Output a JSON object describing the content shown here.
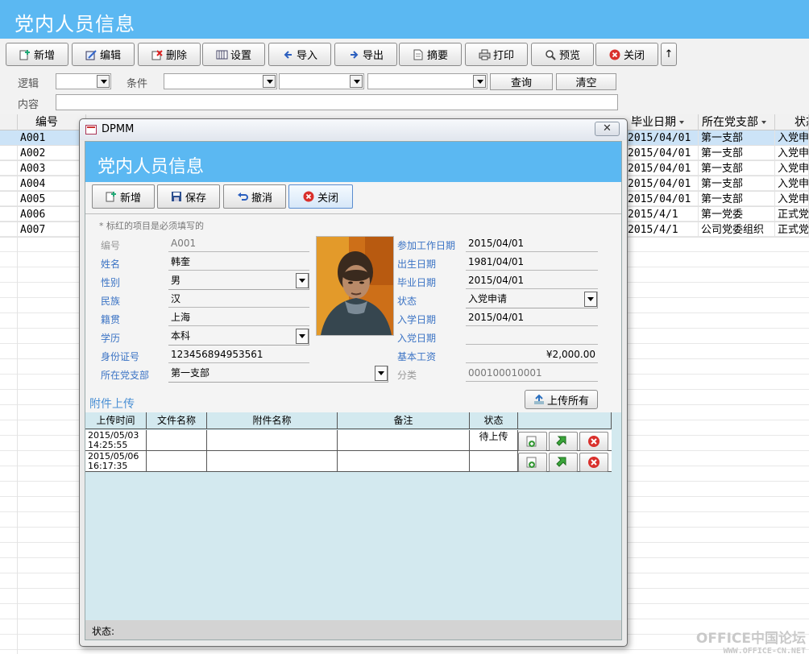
{
  "app": {
    "title": "党内人员信息"
  },
  "toolbar": [
    {
      "label": "新增",
      "icon": "new-icon"
    },
    {
      "label": "编辑",
      "icon": "edit-icon"
    },
    {
      "label": "删除",
      "icon": "delete-icon"
    },
    {
      "label": "设置",
      "icon": "settings-icon"
    },
    {
      "label": "导入",
      "icon": "import-icon"
    },
    {
      "label": "导出",
      "icon": "export-icon"
    },
    {
      "label": "摘要",
      "icon": "summary-icon"
    },
    {
      "label": "打印",
      "icon": "print-icon"
    },
    {
      "label": "预览",
      "icon": "preview-icon"
    },
    {
      "label": "关闭",
      "icon": "close-icon"
    },
    {
      "label": "↑",
      "icon": "up-arrow-icon"
    }
  ],
  "filter": {
    "logic_label": "逻辑",
    "logic_value": "",
    "condition_label": "条件",
    "cond1": "",
    "cond2": "",
    "cond3": "",
    "query_label": "查询",
    "clear_label": "清空",
    "content_label": "内容",
    "content_value": ""
  },
  "grid": {
    "columns": [
      "编号",
      "毕业日期",
      "所在党支部",
      "状态"
    ],
    "rows": [
      {
        "id": "A001",
        "grad": "2015/04/01",
        "branch": "第一支部",
        "status": "入党申请"
      },
      {
        "id": "A002",
        "grad": "2015/04/01",
        "branch": "第一支部",
        "status": "入党申请"
      },
      {
        "id": "A003",
        "grad": "2015/04/01",
        "branch": "第一支部",
        "status": "入党申请"
      },
      {
        "id": "A004",
        "grad": "2015/04/01",
        "branch": "第一支部",
        "status": "入党申请"
      },
      {
        "id": "A005",
        "grad": "2015/04/01",
        "branch": "第一支部",
        "status": "入党申请"
      },
      {
        "id": "A006",
        "grad": "2015/4/1",
        "branch": "第一党委",
        "status": "正式党员"
      },
      {
        "id": "A007",
        "grad": "2015/4/1",
        "branch": "公司党委组织",
        "status": "正式党员"
      }
    ]
  },
  "dialog": {
    "window_title": "DPMM",
    "header_title": "党内人员信息",
    "buttons": {
      "new": "新增",
      "save": "保存",
      "undo": "撤消",
      "close": "关闭"
    },
    "hint": "* 标红的项目是必须填写的",
    "left_fields": {
      "id": {
        "label": "编号",
        "value": "A001"
      },
      "name": {
        "label": "姓名",
        "value": "韩奎"
      },
      "gender": {
        "label": "性别",
        "value": "男"
      },
      "ethnicity": {
        "label": "民族",
        "value": "汉"
      },
      "origin": {
        "label": "籍贯",
        "value": "上海"
      },
      "education": {
        "label": "学历",
        "value": "本科"
      },
      "idcard": {
        "label": "身份证号",
        "value": "123456894953561"
      },
      "branch": {
        "label": "所在党支部",
        "value": "第一支部"
      }
    },
    "right_fields": {
      "workdate": {
        "label": "参加工作日期",
        "value": "2015/04/01"
      },
      "birthdate": {
        "label": "出生日期",
        "value": "1981/04/01"
      },
      "graddate": {
        "label": "毕业日期",
        "value": "2015/04/01"
      },
      "status": {
        "label": "状态",
        "value": "入党申请"
      },
      "enrolldate": {
        "label": "入学日期",
        "value": "2015/04/01"
      },
      "joindate": {
        "label": "入党日期",
        "value": ""
      },
      "salary": {
        "label": "基本工资",
        "value": "¥2,000.00"
      },
      "category": {
        "label": "分类",
        "value": "000100010001"
      }
    },
    "upload_title": "附件上传",
    "upload_all_label": "上传所有",
    "attachments": {
      "columns": [
        "上传时间",
        "文件名称",
        "附件名称",
        "备注",
        "状态"
      ],
      "rows": [
        {
          "time": "2015/05/03 14:25:55",
          "file": "",
          "name": "",
          "note": "",
          "status": "待上传"
        },
        {
          "time": "2015/05/06 16:17:35",
          "file": "",
          "name": "",
          "note": "",
          "status": ""
        }
      ]
    },
    "status_label": "状态:"
  },
  "watermark": {
    "line1": "OFFICE中国论坛",
    "line2": "WWW.OFFICE-CN.NET"
  }
}
